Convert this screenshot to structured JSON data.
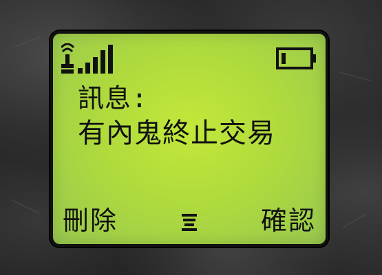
{
  "status_bar": {
    "signal_icon": "signal-strength-icon",
    "battery_icon": "battery-icon",
    "signal_bars": 4,
    "battery_level": 0.15
  },
  "screen": {
    "label": "訊息:",
    "message": "有內鬼終止交易"
  },
  "softkeys": {
    "left_label": "刪除",
    "center_icon": "menu-icon",
    "right_label": "確認"
  },
  "colors": {
    "screen_bg": "#b0db3c",
    "text": "#111111",
    "background": "#2a2a2a"
  }
}
